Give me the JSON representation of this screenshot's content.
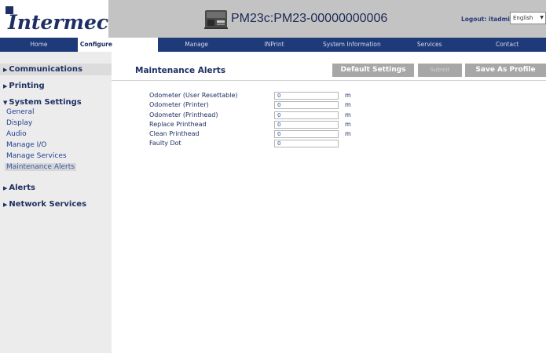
{
  "header": {
    "logo_text": "Intermec",
    "device_title": "PM23c:PM23-00000000006",
    "logout_prefix": "Logout:",
    "logout_user": "itadmin",
    "language": "English"
  },
  "nav": {
    "tabs": [
      {
        "label": "Home"
      },
      {
        "label": "Configure"
      },
      {
        "label": "Manage"
      },
      {
        "label": "INPrint"
      },
      {
        "label": "System Information"
      },
      {
        "label": "Services"
      },
      {
        "label": "Contact"
      }
    ],
    "active_tab": "Configure"
  },
  "sidebar": {
    "groups": [
      {
        "label": "Communications",
        "expanded": false
      },
      {
        "label": "Printing",
        "expanded": false
      },
      {
        "label": "System Settings",
        "expanded": true
      },
      {
        "label": "Alerts",
        "expanded": false
      },
      {
        "label": "Network Services",
        "expanded": false
      }
    ],
    "system_settings_items": [
      {
        "label": "General"
      },
      {
        "label": "Display"
      },
      {
        "label": "Audio"
      },
      {
        "label": "Manage I/O"
      },
      {
        "label": "Manage Services"
      },
      {
        "label": "Maintenance Alerts"
      }
    ],
    "selected_item": "Maintenance Alerts"
  },
  "main": {
    "title": "Maintenance Alerts",
    "buttons": {
      "default_settings": "Default Settings",
      "submit": "Submit",
      "save_as_profile": "Save As Profile"
    },
    "fields": [
      {
        "label": "Odometer (User Resettable)",
        "value": "0",
        "unit": "m"
      },
      {
        "label": "Odometer (Printer)",
        "value": "0",
        "unit": "m"
      },
      {
        "label": "Odometer (Printhead)",
        "value": "0",
        "unit": "m"
      },
      {
        "label": "Replace Printhead",
        "value": "0",
        "unit": "m"
      },
      {
        "label": "Clean Printhead",
        "value": "0",
        "unit": "m"
      },
      {
        "label": "Faulty Dot",
        "value": "0",
        "unit": ""
      }
    ]
  },
  "colors": {
    "navy": "#1f2f63",
    "nav_bar": "#1f3a78",
    "header_gray": "#c3c3c3",
    "sidebar_bg": "#ececec",
    "button_gray": "#a7a7a7"
  },
  "icons": {
    "printer": "printer-icon",
    "expand": "triangle-right-icon",
    "collapse": "triangle-down-icon"
  }
}
